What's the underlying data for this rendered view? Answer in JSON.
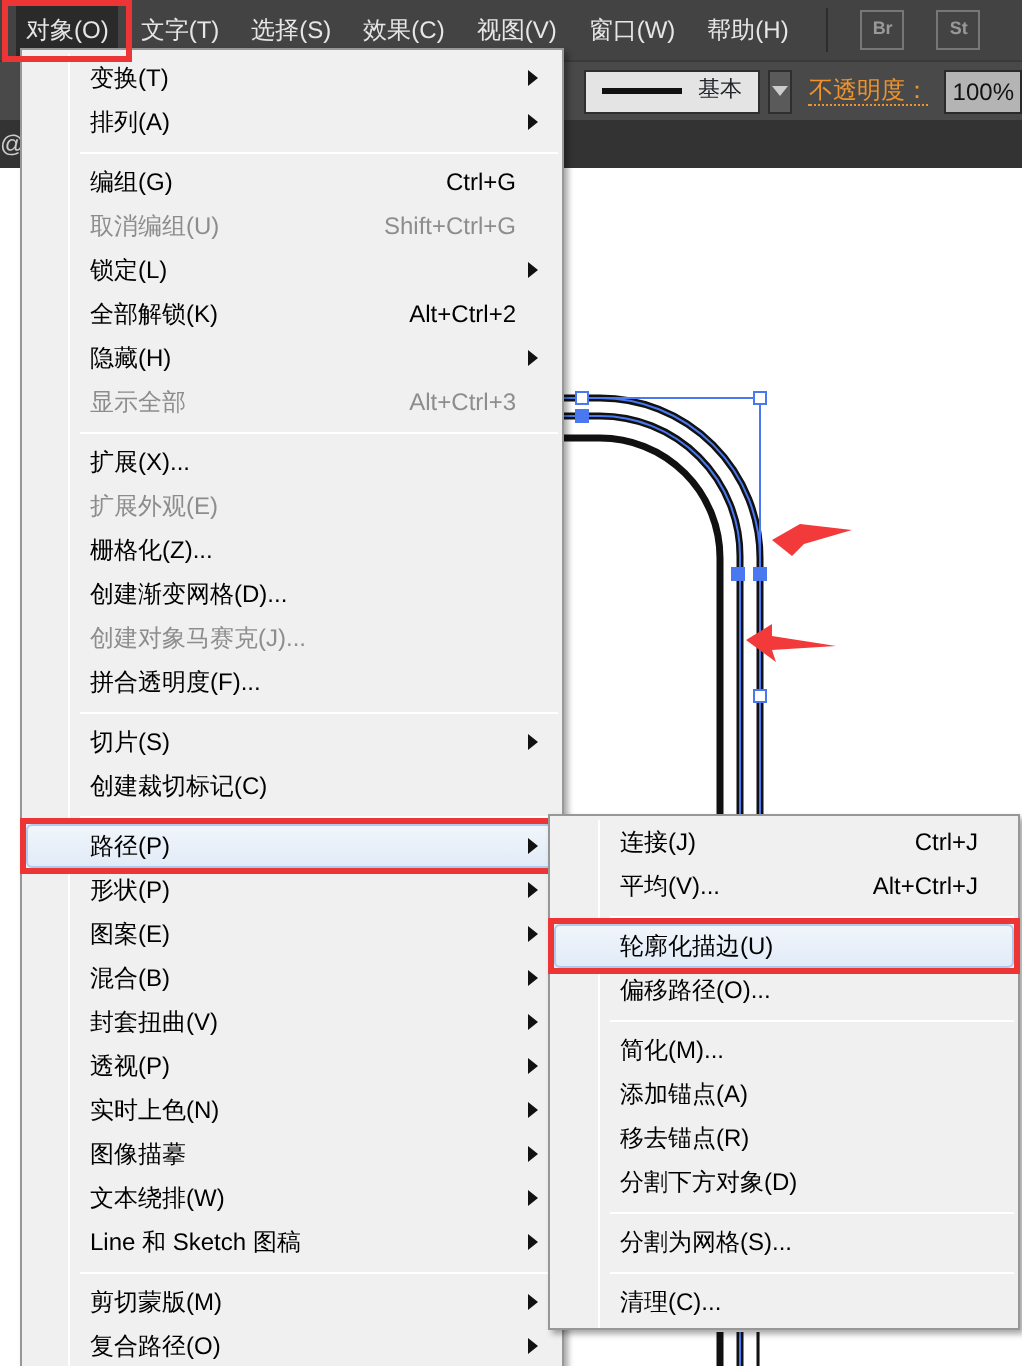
{
  "menubar": [
    {
      "label": "对象(O)",
      "selected": true,
      "annotated": true
    },
    {
      "label": "文字(T)",
      "selected": false,
      "annotated": false
    },
    {
      "label": "选择(S)",
      "selected": false,
      "annotated": false
    },
    {
      "label": "效果(C)",
      "selected": false,
      "annotated": false
    },
    {
      "label": "视图(V)",
      "selected": false,
      "annotated": false
    },
    {
      "label": "窗口(W)",
      "selected": false,
      "annotated": false
    },
    {
      "label": "帮助(H)",
      "selected": false,
      "annotated": false
    }
  ],
  "app_buttons": [
    "Br",
    "St"
  ],
  "control_bar": {
    "stroke_style": "基本",
    "opacity_label": "不透明度：",
    "opacity_value": "100%"
  },
  "document_tab": "@",
  "menu": {
    "items": [
      {
        "kind": "item",
        "label": "变换(T)",
        "submenu": true,
        "disabled": false,
        "selected": false,
        "annotated": false
      },
      {
        "kind": "item",
        "label": "排列(A)",
        "submenu": true,
        "disabled": false,
        "selected": false,
        "annotated": false
      },
      {
        "kind": "separator"
      },
      {
        "kind": "item",
        "label": "编组(G)",
        "shortcut": "Ctrl+G",
        "submenu": false,
        "disabled": false,
        "selected": false,
        "annotated": false
      },
      {
        "kind": "item",
        "label": "取消编组(U)",
        "shortcut": "Shift+Ctrl+G",
        "submenu": false,
        "disabled": true,
        "selected": false,
        "annotated": false
      },
      {
        "kind": "item",
        "label": "锁定(L)",
        "submenu": true,
        "disabled": false,
        "selected": false,
        "annotated": false
      },
      {
        "kind": "item",
        "label": "全部解锁(K)",
        "shortcut": "Alt+Ctrl+2",
        "submenu": false,
        "disabled": false,
        "selected": false,
        "annotated": false
      },
      {
        "kind": "item",
        "label": "隐藏(H)",
        "submenu": true,
        "disabled": false,
        "selected": false,
        "annotated": false
      },
      {
        "kind": "item",
        "label": "显示全部",
        "shortcut": "Alt+Ctrl+3",
        "submenu": false,
        "disabled": true,
        "selected": false,
        "annotated": false
      },
      {
        "kind": "separator"
      },
      {
        "kind": "item",
        "label": "扩展(X)...",
        "submenu": false,
        "disabled": false,
        "selected": false,
        "annotated": false
      },
      {
        "kind": "item",
        "label": "扩展外观(E)",
        "submenu": false,
        "disabled": true,
        "selected": false,
        "annotated": false
      },
      {
        "kind": "item",
        "label": "栅格化(Z)...",
        "submenu": false,
        "disabled": false,
        "selected": false,
        "annotated": false
      },
      {
        "kind": "item",
        "label": "创建渐变网格(D)...",
        "submenu": false,
        "disabled": false,
        "selected": false,
        "annotated": false
      },
      {
        "kind": "item",
        "label": "创建对象马赛克(J)...",
        "submenu": false,
        "disabled": true,
        "selected": false,
        "annotated": false
      },
      {
        "kind": "item",
        "label": "拼合透明度(F)...",
        "submenu": false,
        "disabled": false,
        "selected": false,
        "annotated": false
      },
      {
        "kind": "separator"
      },
      {
        "kind": "item",
        "label": "切片(S)",
        "submenu": true,
        "disabled": false,
        "selected": false,
        "annotated": false
      },
      {
        "kind": "item",
        "label": "创建裁切标记(C)",
        "submenu": false,
        "disabled": false,
        "selected": false,
        "annotated": false
      },
      {
        "kind": "separator"
      },
      {
        "kind": "item",
        "label": "路径(P)",
        "submenu": true,
        "disabled": false,
        "selected": true,
        "annotated": true
      },
      {
        "kind": "item",
        "label": "形状(P)",
        "submenu": true,
        "disabled": false,
        "selected": false,
        "annotated": false
      },
      {
        "kind": "item",
        "label": "图案(E)",
        "submenu": true,
        "disabled": false,
        "selected": false,
        "annotated": false
      },
      {
        "kind": "item",
        "label": "混合(B)",
        "submenu": true,
        "disabled": false,
        "selected": false,
        "annotated": false
      },
      {
        "kind": "item",
        "label": "封套扭曲(V)",
        "submenu": true,
        "disabled": false,
        "selected": false,
        "annotated": false
      },
      {
        "kind": "item",
        "label": "透视(P)",
        "submenu": true,
        "disabled": false,
        "selected": false,
        "annotated": false
      },
      {
        "kind": "item",
        "label": "实时上色(N)",
        "submenu": true,
        "disabled": false,
        "selected": false,
        "annotated": false
      },
      {
        "kind": "item",
        "label": "图像描摹",
        "submenu": true,
        "disabled": false,
        "selected": false,
        "annotated": false
      },
      {
        "kind": "item",
        "label": "文本绕排(W)",
        "submenu": true,
        "disabled": false,
        "selected": false,
        "annotated": false
      },
      {
        "kind": "item",
        "label": "Line 和 Sketch 图稿",
        "submenu": true,
        "disabled": false,
        "selected": false,
        "annotated": false
      },
      {
        "kind": "separator"
      },
      {
        "kind": "item",
        "label": "剪切蒙版(M)",
        "submenu": true,
        "disabled": false,
        "selected": false,
        "annotated": false
      },
      {
        "kind": "item",
        "label": "复合路径(O)",
        "submenu": true,
        "disabled": false,
        "selected": false,
        "annotated": false
      }
    ]
  },
  "submenu": {
    "items": [
      {
        "kind": "item",
        "label": "连接(J)",
        "shortcut": "Ctrl+J",
        "submenu": false,
        "disabled": false,
        "selected": false,
        "annotated": false
      },
      {
        "kind": "item",
        "label": "平均(V)...",
        "shortcut": "Alt+Ctrl+J",
        "submenu": false,
        "disabled": false,
        "selected": false,
        "annotated": false
      },
      {
        "kind": "separator"
      },
      {
        "kind": "item",
        "label": "轮廓化描边(U)",
        "submenu": false,
        "disabled": false,
        "selected": true,
        "annotated": true
      },
      {
        "kind": "item",
        "label": "偏移路径(O)...",
        "submenu": false,
        "disabled": false,
        "selected": false,
        "annotated": false
      },
      {
        "kind": "separator"
      },
      {
        "kind": "item",
        "label": "简化(M)...",
        "submenu": false,
        "disabled": false,
        "selected": false,
        "annotated": false
      },
      {
        "kind": "item",
        "label": "添加锚点(A)",
        "submenu": false,
        "disabled": false,
        "selected": false,
        "annotated": false
      },
      {
        "kind": "item",
        "label": "移去锚点(R)",
        "submenu": false,
        "disabled": false,
        "selected": false,
        "annotated": false
      },
      {
        "kind": "item",
        "label": "分割下方对象(D)",
        "submenu": false,
        "disabled": false,
        "selected": false,
        "annotated": false
      },
      {
        "kind": "separator"
      },
      {
        "kind": "item",
        "label": "分割为网格(S)...",
        "submenu": false,
        "disabled": false,
        "selected": false,
        "annotated": false
      },
      {
        "kind": "separator"
      },
      {
        "kind": "item",
        "label": "清理(C)...",
        "submenu": false,
        "disabled": false,
        "selected": false,
        "annotated": false
      }
    ]
  }
}
